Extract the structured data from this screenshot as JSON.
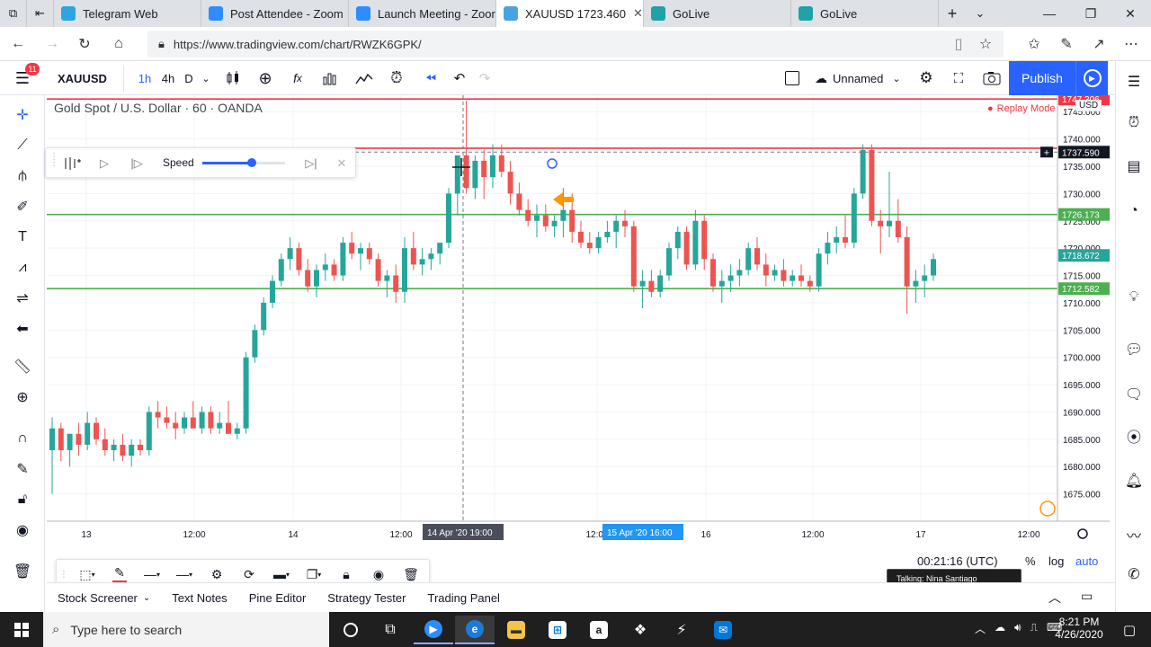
{
  "browser": {
    "tabs": [
      {
        "label": "Telegram Web",
        "color": "#2ca5e0",
        "active": false
      },
      {
        "label": "Post Attendee - Zoom",
        "color": "#2d8cff",
        "active": false
      },
      {
        "label": "Launch Meeting - Zoor",
        "color": "#2d8cff",
        "active": false
      },
      {
        "label": "XAUUSD 1723.460",
        "color": "#4aa3df",
        "active": true
      },
      {
        "label": "GoLive",
        "color": "#1fa2a8",
        "active": false
      },
      {
        "label": "GoLive",
        "color": "#1fa2a8",
        "active": false
      }
    ],
    "url": "https://www.tradingview.com/chart/RWZK6GPK/"
  },
  "toolbar": {
    "symbol": "XAUUSD",
    "intervals": [
      "1h",
      "4h",
      "D"
    ],
    "badge": "11",
    "layout_name": "Unnamed",
    "publish_label": "Publish"
  },
  "chart": {
    "legend": "Gold Spot / U.S. Dollar · 60 · OANDA",
    "replay_mode": "Replay Mode",
    "currency": "USD",
    "speed_label": "Speed",
    "clock": "00:21:16 (UTC)",
    "pct": "%",
    "log": "log",
    "auto": "auto",
    "crosshair_date": "14 Apr '20",
    "crosshair_time": "19:00",
    "highlight_date": "15 Apr '20",
    "highlight_time": "16:00"
  },
  "chart_data": {
    "type": "candlestick",
    "title": "Gold Spot / U.S. Dollar · 60 · OANDA",
    "ylim": [
      1670,
      1748
    ],
    "y_ticks": [
      1675,
      1680,
      1685,
      1690,
      1695,
      1700,
      1705,
      1710,
      1715,
      1720,
      1725,
      1730,
      1735,
      1740,
      1745
    ],
    "x_ticks": [
      "13",
      "12:00",
      "14",
      "12:00",
      "15",
      "12:00",
      "16",
      "12:00",
      "17",
      "12:00"
    ],
    "horizontal_lines": [
      {
        "price": 1747.306,
        "label": "1747.306",
        "color": "#f23645"
      },
      {
        "price": 1738.3,
        "label": "",
        "color": "#f23645"
      },
      {
        "price": 1726.173,
        "label": "1726.173",
        "color": "#4caf50"
      },
      {
        "price": 1712.582,
        "label": "1712.582",
        "color": "#4caf50"
      }
    ],
    "price_labels": [
      {
        "price": 1737.59,
        "label": "1737.590",
        "color": "#131722"
      },
      {
        "price": 1718.672,
        "label": "1718.672",
        "color": "#26a69a"
      }
    ],
    "candles": [
      [
        1683,
        1689,
        1675,
        1687
      ],
      [
        1687,
        1688,
        1681,
        1683
      ],
      [
        1683,
        1686,
        1680,
        1686
      ],
      [
        1686,
        1688,
        1682,
        1684
      ],
      [
        1684,
        1690,
        1683,
        1688
      ],
      [
        1688,
        1689,
        1684,
        1685
      ],
      [
        1685,
        1687,
        1682,
        1683
      ],
      [
        1683,
        1685,
        1681,
        1684
      ],
      [
        1684,
        1686,
        1681,
        1682
      ],
      [
        1682,
        1685,
        1680,
        1684
      ],
      [
        1684,
        1685,
        1682,
        1683
      ],
      [
        1683,
        1691,
        1682,
        1690
      ],
      [
        1690,
        1692,
        1687,
        1689
      ],
      [
        1689,
        1691,
        1687,
        1688
      ],
      [
        1688,
        1690,
        1685,
        1687
      ],
      [
        1687,
        1690,
        1686,
        1689
      ],
      [
        1689,
        1692,
        1687,
        1687
      ],
      [
        1687,
        1691,
        1686,
        1690
      ],
      [
        1690,
        1691,
        1686,
        1687
      ],
      [
        1687,
        1690,
        1686,
        1688
      ],
      [
        1688,
        1692,
        1687,
        1686
      ],
      [
        1686,
        1688,
        1685,
        1687
      ],
      [
        1687,
        1701,
        1686,
        1700
      ],
      [
        1700,
        1706,
        1699,
        1705
      ],
      [
        1705,
        1711,
        1704,
        1710
      ],
      [
        1710,
        1715,
        1709,
        1714
      ],
      [
        1714,
        1719,
        1713,
        1718
      ],
      [
        1718,
        1722,
        1716,
        1720
      ],
      [
        1720,
        1721,
        1715,
        1716
      ],
      [
        1716,
        1718,
        1712,
        1713
      ],
      [
        1713,
        1717,
        1711,
        1716
      ],
      [
        1716,
        1719,
        1714,
        1717
      ],
      [
        1717,
        1718,
        1714,
        1715
      ],
      [
        1715,
        1722,
        1714,
        1721
      ],
      [
        1721,
        1723,
        1718,
        1719
      ],
      [
        1719,
        1721,
        1716,
        1720
      ],
      [
        1720,
        1721,
        1717,
        1718
      ],
      [
        1718,
        1719,
        1713,
        1714
      ],
      [
        1714,
        1716,
        1711,
        1715
      ],
      [
        1715,
        1717,
        1710,
        1712
      ],
      [
        1712,
        1722,
        1710,
        1720
      ],
      [
        1720,
        1723,
        1716,
        1717
      ],
      [
        1717,
        1720,
        1715,
        1718
      ],
      [
        1718,
        1720,
        1716,
        1719
      ],
      [
        1719,
        1720,
        1717,
        1721
      ],
      [
        1721,
        1731,
        1720,
        1730
      ],
      [
        1730,
        1737,
        1726,
        1737
      ],
      [
        1737,
        1747,
        1730,
        1731
      ],
      [
        1731,
        1737,
        1729,
        1736
      ],
      [
        1736,
        1738,
        1729,
        1733
      ],
      [
        1733,
        1739,
        1731,
        1737
      ],
      [
        1737,
        1739,
        1733,
        1734
      ],
      [
        1734,
        1736,
        1728,
        1730
      ],
      [
        1730,
        1732,
        1726,
        1727
      ],
      [
        1727,
        1729,
        1724,
        1725
      ],
      [
        1725,
        1728,
        1722,
        1726
      ],
      [
        1726,
        1728,
        1723,
        1724
      ],
      [
        1724,
        1726,
        1722,
        1725
      ],
      [
        1725,
        1731,
        1722,
        1727
      ],
      [
        1727,
        1730,
        1721,
        1723
      ],
      [
        1723,
        1725,
        1720,
        1721
      ],
      [
        1721,
        1723,
        1719,
        1720
      ],
      [
        1720,
        1723,
        1719,
        1722
      ],
      [
        1722,
        1725,
        1721,
        1723
      ],
      [
        1723,
        1726,
        1720,
        1725
      ],
      [
        1725,
        1727,
        1722,
        1724
      ],
      [
        1724,
        1725,
        1712,
        1713
      ],
      [
        1713,
        1716,
        1709,
        1714
      ],
      [
        1714,
        1716,
        1711,
        1712
      ],
      [
        1712,
        1716,
        1711,
        1715
      ],
      [
        1715,
        1721,
        1714,
        1720
      ],
      [
        1720,
        1724,
        1718,
        1723
      ],
      [
        1723,
        1724,
        1716,
        1717
      ],
      [
        1717,
        1727,
        1716,
        1725
      ],
      [
        1725,
        1726,
        1716,
        1718
      ],
      [
        1718,
        1719,
        1712,
        1713
      ],
      [
        1713,
        1716,
        1710,
        1714
      ],
      [
        1714,
        1717,
        1712,
        1715
      ],
      [
        1715,
        1718,
        1713,
        1716
      ],
      [
        1716,
        1721,
        1715,
        1720
      ],
      [
        1720,
        1722,
        1716,
        1717
      ],
      [
        1717,
        1719,
        1713,
        1715
      ],
      [
        1715,
        1717,
        1714,
        1716
      ],
      [
        1716,
        1718,
        1713,
        1714
      ],
      [
        1714,
        1716,
        1713,
        1715
      ],
      [
        1715,
        1717,
        1713,
        1714
      ],
      [
        1714,
        1715,
        1712,
        1713
      ],
      [
        1713,
        1720,
        1712,
        1719
      ],
      [
        1719,
        1723,
        1717,
        1721
      ],
      [
        1721,
        1724,
        1719,
        1722
      ],
      [
        1722,
        1726,
        1720,
        1721
      ],
      [
        1721,
        1731,
        1720,
        1730
      ],
      [
        1730,
        1739,
        1729,
        1738
      ],
      [
        1738,
        1739,
        1724,
        1725
      ],
      [
        1725,
        1727,
        1719,
        1724
      ],
      [
        1724,
        1734,
        1722,
        1725
      ],
      [
        1725,
        1729,
        1721,
        1722
      ],
      [
        1722,
        1724,
        1708,
        1713
      ],
      [
        1713,
        1716,
        1710,
        1714
      ],
      [
        1714,
        1717,
        1711,
        1715
      ],
      [
        1715,
        1719,
        1714,
        1718
      ]
    ],
    "bull_color": "#26a69a",
    "bear_color": "#ef5350"
  },
  "left_tools": [
    "crosshair-icon",
    "trend-line-icon",
    "pitchfork-icon",
    "brush-icon",
    "text-icon",
    "pattern-icon",
    "prediction-icon",
    "back-arrow-icon",
    "ruler-icon",
    "zoom-icon",
    "magnet-icon",
    "lock-draw-icon",
    "unlock-icon",
    "eye-icon",
    "trash-icon"
  ],
  "right_tools": [
    "watchlist-icon",
    "alarm-icon",
    "calendar-icon",
    "hotlist-icon",
    "ideas-icon",
    "chat-icon",
    "streams-icon",
    "broadcast-icon",
    "notification-icon",
    "pulse-icon",
    "phone-icon"
  ],
  "bottom_tabs": [
    "Stock Screener",
    "Text Notes",
    "Pine Editor",
    "Strategy Tester",
    "Trading Panel"
  ],
  "tooltip": "Talking: Nina Santiago",
  "taskbar": {
    "search_placeholder": "Type here to search",
    "time": "8:21 PM",
    "date": "4/26/2020"
  }
}
